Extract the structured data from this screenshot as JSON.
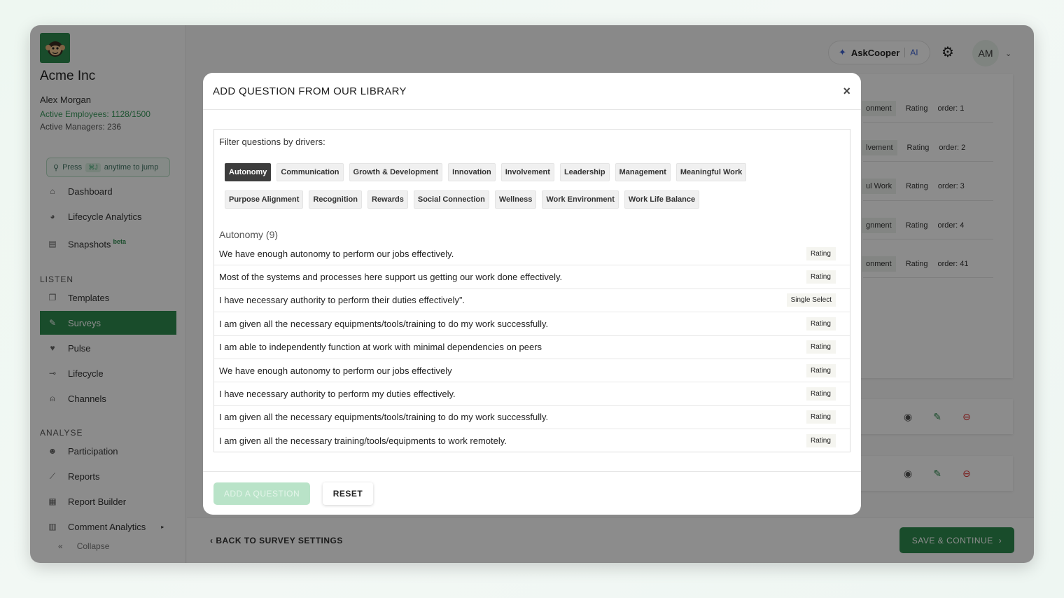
{
  "sidebar": {
    "company": "Acme Inc",
    "user": "Alex Morgan",
    "active_employees": "Active Employees: 1128/1500",
    "active_managers": "Active Managers: 236",
    "jump_press": "Press",
    "jump_key": "⌘J",
    "jump_rest": "anytime to jump",
    "items_top": [
      {
        "label": "Dashboard",
        "icon": "home-icon"
      },
      {
        "label": "Lifecycle Analytics",
        "icon": "pie-chart-icon"
      },
      {
        "label": "Snapshots",
        "icon": "snapshot-icon",
        "badge": "beta"
      }
    ],
    "listen_label": "LISTEN",
    "items_listen": [
      {
        "label": "Templates",
        "icon": "templates-icon"
      },
      {
        "label": "Surveys",
        "icon": "pencil-icon",
        "active": true
      },
      {
        "label": "Pulse",
        "icon": "heart-pulse-icon"
      },
      {
        "label": "Lifecycle",
        "icon": "lifecycle-icon"
      },
      {
        "label": "Channels",
        "icon": "broadcast-icon"
      }
    ],
    "analyse_label": "ANALYSE",
    "items_analyse": [
      {
        "label": "Participation",
        "icon": "user-check-icon"
      },
      {
        "label": "Reports",
        "icon": "line-chart-icon"
      },
      {
        "label": "Report Builder",
        "icon": "report-builder-icon"
      },
      {
        "label": "Comment Analytics",
        "icon": "bar-chart-icon"
      }
    ],
    "collapse": "Collapse"
  },
  "topbar": {
    "ask": "AskCooper",
    "ai": "AI",
    "avatar": "AM"
  },
  "background_rows": [
    {
      "driver": "onment",
      "type": "Rating",
      "order": "order: 1"
    },
    {
      "driver": "lvement",
      "type": "Rating",
      "order": "order: 2"
    },
    {
      "driver": "ul Work",
      "type": "Rating",
      "order": "order: 3"
    },
    {
      "driver": "gnment",
      "type": "Rating",
      "order": "order: 4"
    },
    {
      "driver": "onment",
      "type": "Rating",
      "order": "order: 41"
    }
  ],
  "bottom": {
    "back": "BACK TO SURVEY SETTINGS",
    "save": "SAVE & CONTINUE"
  },
  "modal": {
    "title": "ADD QUESTION FROM OUR LIBRARY",
    "close": "×",
    "filter_label": "Filter questions by drivers:",
    "drivers_row1": [
      "Autonomy",
      "Communication",
      "Growth & Development",
      "Innovation",
      "Involvement",
      "Leadership",
      "Management",
      "Meaningful Work"
    ],
    "drivers_row2": [
      "Purpose Alignment",
      "Recognition",
      "Rewards",
      "Social Connection",
      "Wellness",
      "Work Environment",
      "Work Life Balance"
    ],
    "selected_driver": "Autonomy",
    "group_heading": "Autonomy (9)",
    "questions": [
      {
        "text": "We have enough autonomy to perform our jobs effectively.",
        "type": "Rating"
      },
      {
        "text": "Most of the systems and processes here support us getting our work done effectively.",
        "type": "Rating"
      },
      {
        "text": "I have necessary authority to perform their duties effectively”.",
        "type": "Single Select"
      },
      {
        "text": "I am given all the necessary equipments/tools/training to do my work successfully.",
        "type": "Rating"
      },
      {
        "text": "I am able to independently function at work with minimal dependencies on peers",
        "type": "Rating"
      },
      {
        "text": "We have enough autonomy to perform our jobs effectively",
        "type": "Rating"
      },
      {
        "text": "I have necessary authority to perform my duties effectively.",
        "type": "Rating"
      },
      {
        "text": "I am given all the necessary equipments/tools/training to do my work successfully.",
        "type": "Rating"
      },
      {
        "text": "I am given all the necessary training/tools/equipments to work remotely.",
        "type": "Rating"
      }
    ],
    "add_button": "ADD A QUESTION",
    "reset_button": "RESET"
  }
}
